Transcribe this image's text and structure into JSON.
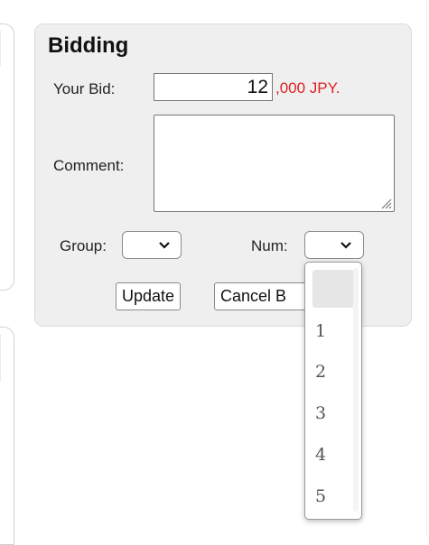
{
  "bidding": {
    "title": "Bidding",
    "your_bid_label": "Your Bid:",
    "bid_value": "12",
    "bid_unit": ",000 JPY.",
    "comment_label": "Comment:",
    "comment_value": "",
    "group_label": "Group:",
    "group_selected": "",
    "num_label": "Num:",
    "num_selected": "",
    "update_button": "Update",
    "cancel_button": "Cancel B",
    "accent_color": "#e02020"
  },
  "num_dropdown": {
    "options": [
      "",
      "1",
      "2",
      "3",
      "4",
      "5"
    ],
    "highlighted_index": 0
  }
}
